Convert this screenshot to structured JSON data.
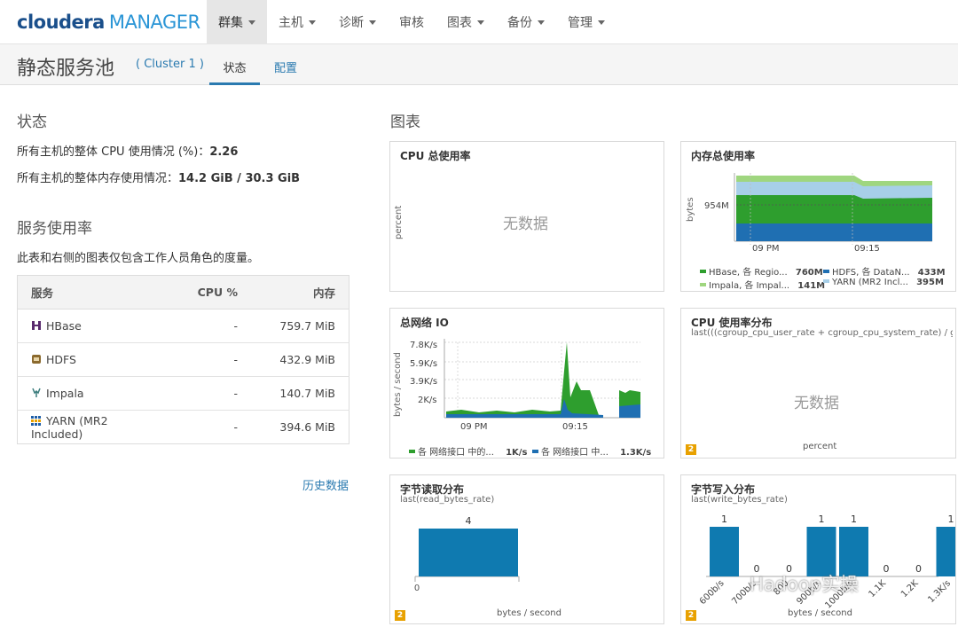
{
  "brand": {
    "bold": "cloudera",
    "light": "MANAGER"
  },
  "nav": [
    {
      "label": "群集",
      "dropdown": true,
      "active": true
    },
    {
      "label": "主机",
      "dropdown": true
    },
    {
      "label": "诊断",
      "dropdown": true
    },
    {
      "label": "审核",
      "dropdown": false
    },
    {
      "label": "图表",
      "dropdown": true
    },
    {
      "label": "备份",
      "dropdown": true
    },
    {
      "label": "管理",
      "dropdown": true
    }
  ],
  "page": {
    "title": "静态服务池",
    "cluster": "( Cluster 1 )",
    "tab_status": "状态",
    "tab_config": "配置"
  },
  "status": {
    "heading": "状态",
    "cpu_label": "所有主机的整体 CPU 使用情况 (%)：",
    "cpu_value": "2.26",
    "mem_label": "所有主机的整体内存使用情况：",
    "mem_value": "14.2 GiB / 30.3 GiB"
  },
  "usage": {
    "heading": "服务使用率",
    "note": "此表和右侧的图表仅包含工作人员角色的度量。",
    "columns": [
      "服务",
      "CPU %",
      "内存"
    ],
    "rows": [
      {
        "name": "HBase",
        "icon": "hbase-icon",
        "cpu": "-",
        "mem": "759.7 MiB"
      },
      {
        "name": "HDFS",
        "icon": "hdfs-icon",
        "cpu": "-",
        "mem": "432.9 MiB"
      },
      {
        "name": "Impala",
        "icon": "impala-icon",
        "cpu": "-",
        "mem": "140.7 MiB"
      },
      {
        "name": "YARN (MR2 Included)",
        "icon": "yarn-icon",
        "cpu": "-",
        "mem": "394.6 MiB"
      }
    ],
    "history_link": "历史数据"
  },
  "charts_heading": "图表",
  "panels": {
    "cpu_total": {
      "title": "CPU 总使用率",
      "nodata": "无数据",
      "ylabel": "percent"
    },
    "mem_total": {
      "title": "内存总使用率",
      "ylabel": "bytes",
      "ytick": "954M",
      "xticks": [
        "09 PM",
        "09:15"
      ],
      "legend": [
        {
          "label": "HBase, 各 Regio...",
          "value": "760M",
          "color": "#2e9e2e"
        },
        {
          "label": "HDFS, 各 DataN...",
          "value": "433M",
          "color": "#1f6fb2"
        },
        {
          "label": "Impala, 各 Impal...",
          "value": "141M",
          "color": "#9fd67f"
        },
        {
          "label": "YARN (MR2 Incl...",
          "value": "395M",
          "color": "#a7cfe8"
        }
      ]
    },
    "net_io": {
      "title": "总网络 IO",
      "ylabel": "bytes / second",
      "yticks": [
        "7.8K/s",
        "5.9K/s",
        "3.9K/s",
        "2K/s"
      ],
      "xticks": [
        "09 PM",
        "09:15"
      ],
      "legend": [
        {
          "label": "各 网络接口 中的...",
          "value": "1K/s",
          "color": "#2e9e2e"
        },
        {
          "label": "各 网络接口 中...",
          "value": "1.3K/s",
          "color": "#1f6fb2"
        }
      ]
    },
    "cpu_dist": {
      "title": "CPU 使用率分布",
      "subtitle": "last(((cgroup_cpu_user_rate + cgroup_cpu_system_rate) / getCl...",
      "nodata": "无数据",
      "xlabel": "percent",
      "badge": "2"
    },
    "read_dist": {
      "title": "字节读取分布",
      "subtitle": "last(read_bytes_rate)",
      "xlabel": "bytes / second",
      "badge": "2",
      "xtick": "0"
    },
    "write_dist": {
      "title": "字节写入分布",
      "subtitle": "last(write_bytes_rate)",
      "xlabel": "bytes / second",
      "badge": "2"
    }
  },
  "chart_data": [
    {
      "type": "bar",
      "title": "字节读取分布",
      "xlabel": "bytes / second",
      "categories": [
        "0"
      ],
      "values": [
        4
      ]
    },
    {
      "type": "bar",
      "title": "字节写入分布",
      "xlabel": "bytes / second",
      "categories": [
        "600b/s",
        "700b/s",
        "800",
        "900b/s",
        "1000b/s",
        "1.1K",
        "1.2K",
        "1.3K/s"
      ],
      "values": [
        1,
        0,
        0,
        1,
        1,
        0,
        0,
        1
      ]
    }
  ],
  "watermark": "Hadoop实操"
}
